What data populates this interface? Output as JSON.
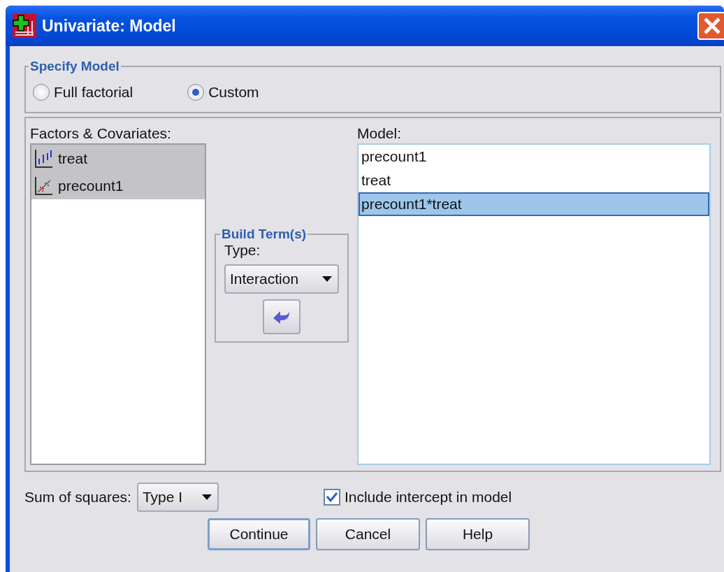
{
  "window": {
    "title": "Univariate: Model"
  },
  "specify_model": {
    "title": "Specify Model",
    "options": [
      {
        "label": "Full factorial",
        "selected": false
      },
      {
        "label": "Custom",
        "selected": true
      }
    ]
  },
  "factors": {
    "label": "Factors & Covariates:",
    "items": [
      {
        "name": "treat",
        "kind": "nominal",
        "selected": true
      },
      {
        "name": "precount1",
        "kind": "scale",
        "selected": true
      }
    ]
  },
  "build_terms": {
    "title": "Build Term(s)",
    "type_label": "Type:",
    "type_value": "Interaction"
  },
  "model": {
    "label": "Model:",
    "items": [
      {
        "name": "precount1",
        "selected": false
      },
      {
        "name": "treat",
        "selected": false
      },
      {
        "name": "precount1*treat",
        "selected": true
      }
    ]
  },
  "sum_of_squares": {
    "label": "Sum of squares:",
    "value": "Type I"
  },
  "include_intercept": {
    "label": "Include intercept in model",
    "checked": true
  },
  "buttons": [
    {
      "label": "Continue",
      "default": true
    },
    {
      "label": "Cancel",
      "default": false
    },
    {
      "label": "Help",
      "default": false
    }
  ]
}
